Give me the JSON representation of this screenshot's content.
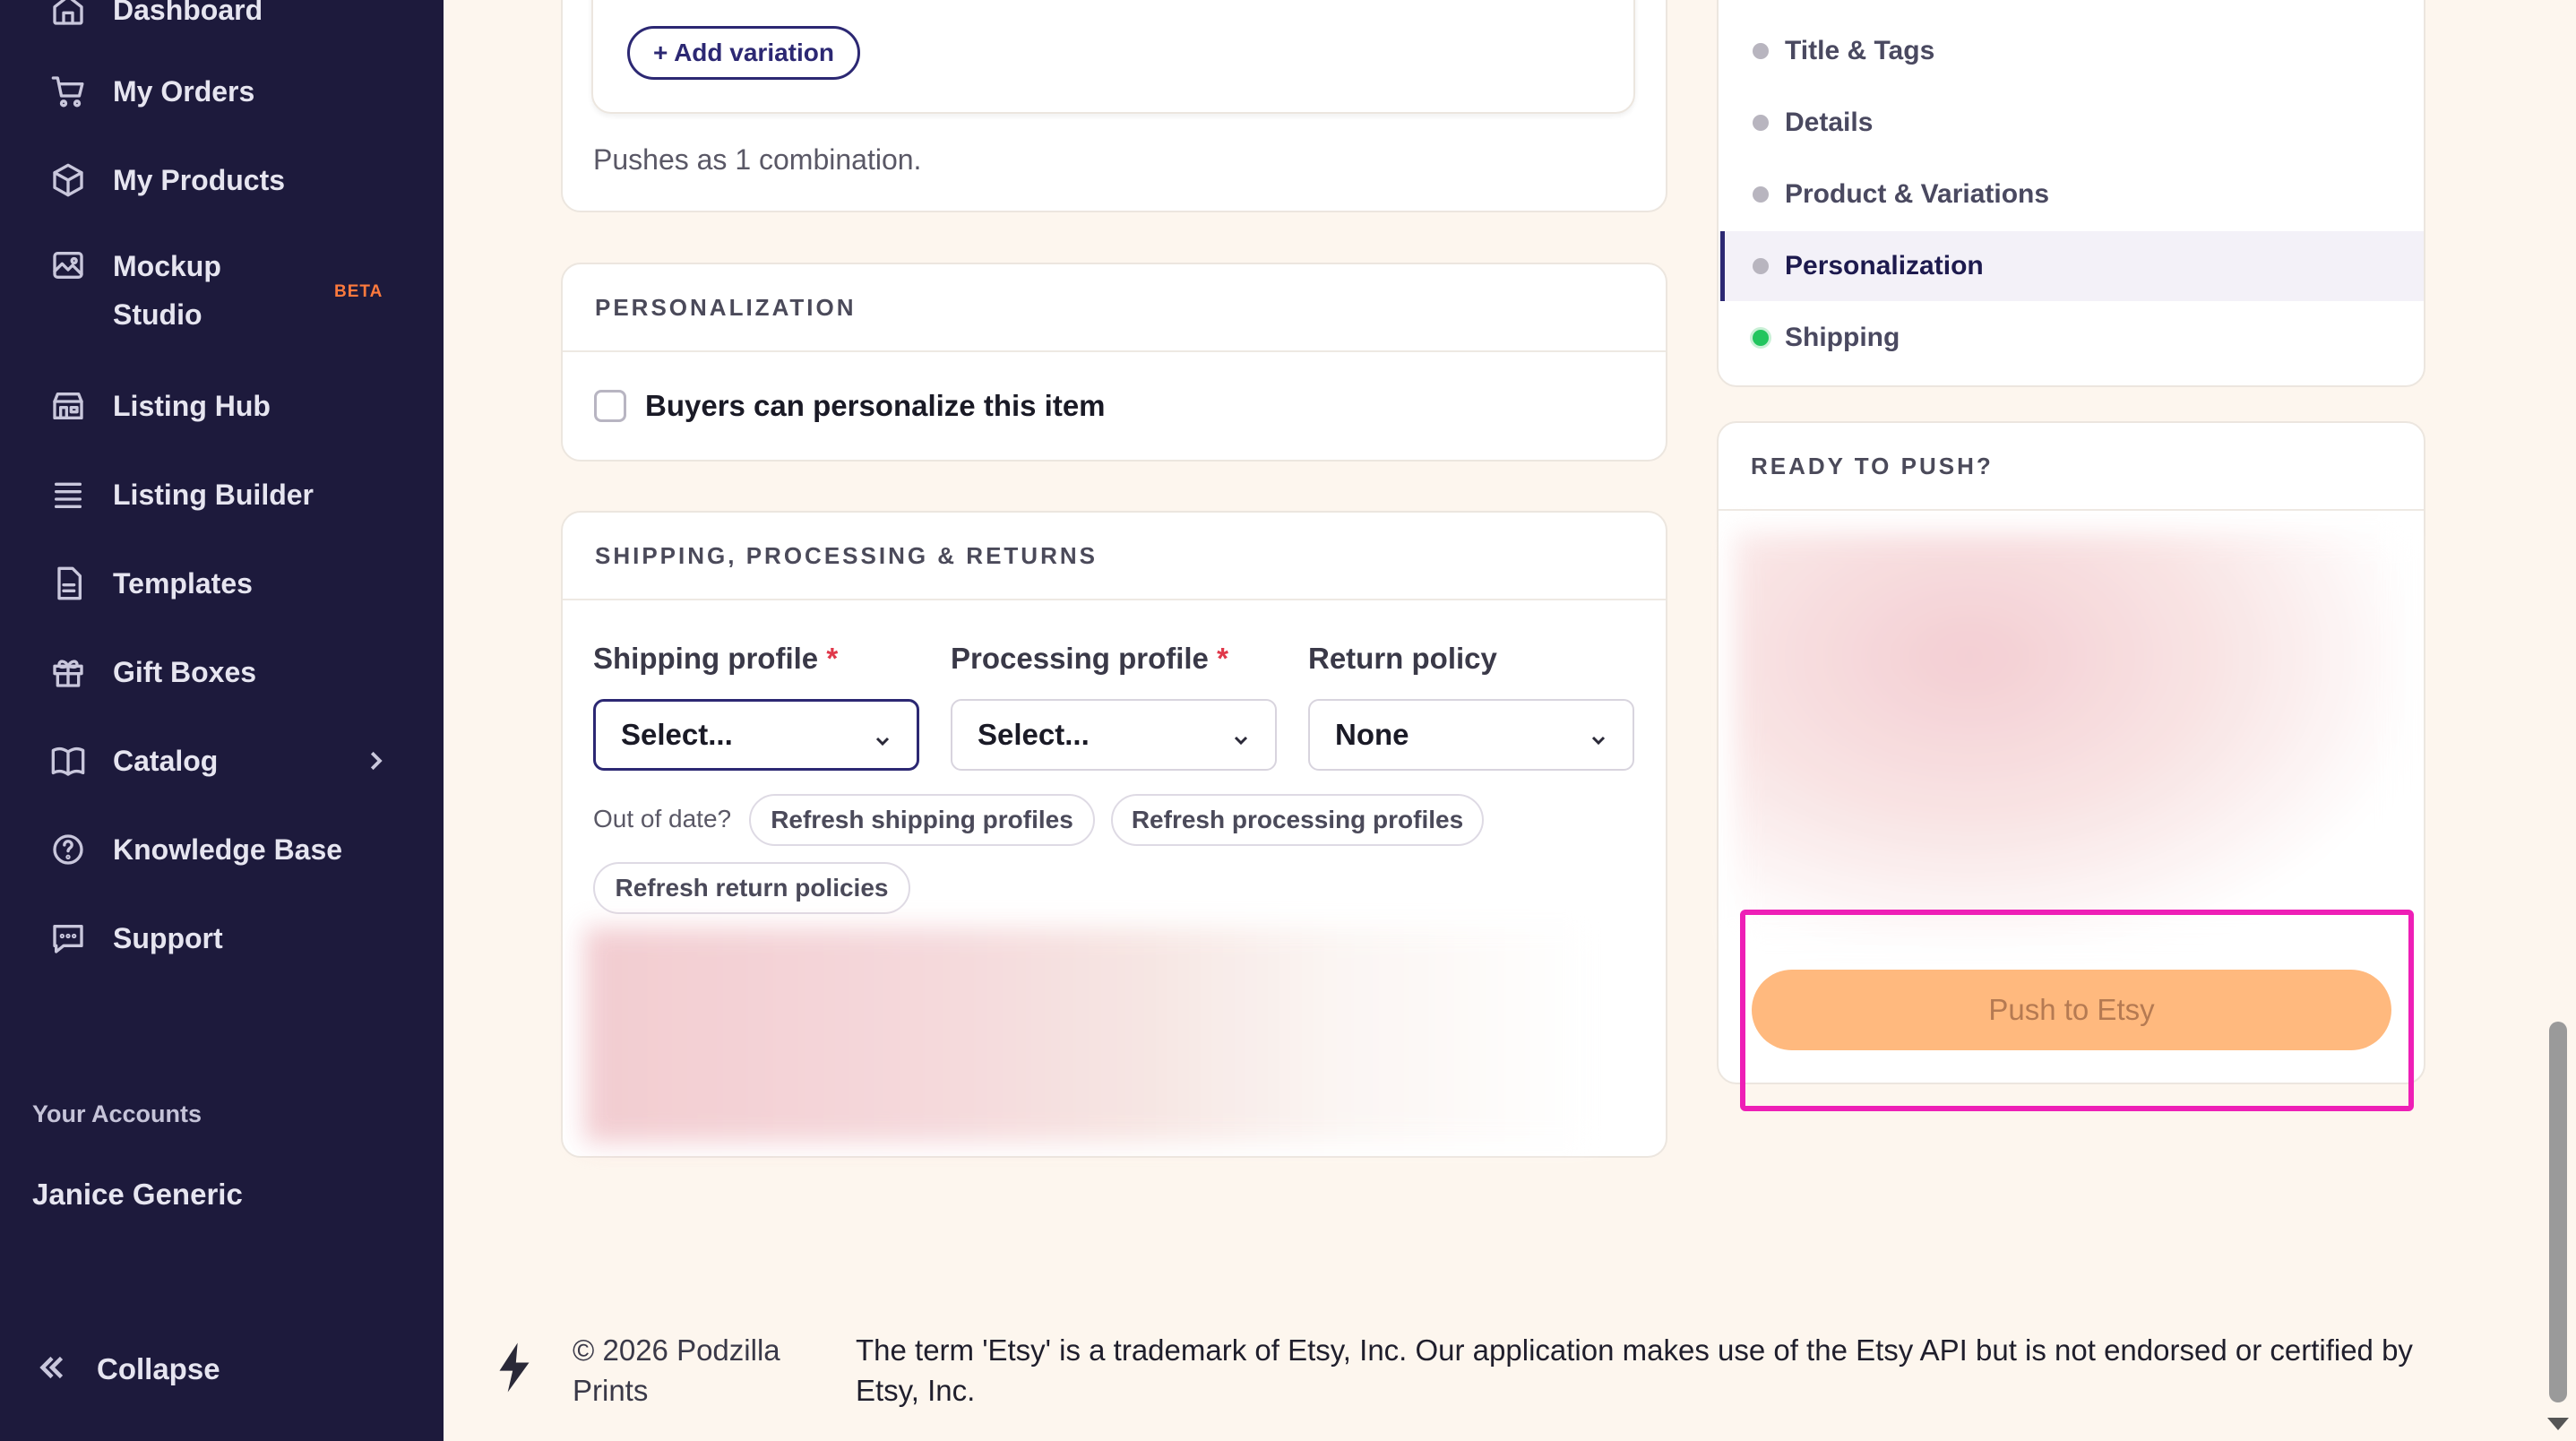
{
  "sidebar": {
    "items": [
      {
        "label": "Dashboard",
        "icon": "home-icon"
      },
      {
        "label": "My Orders",
        "icon": "cart-icon"
      },
      {
        "label": "My Products",
        "icon": "box-icon"
      },
      {
        "label": "Mockup Studio",
        "icon": "image-icon",
        "badge": "BETA"
      },
      {
        "label": "Listing Hub",
        "icon": "store-icon"
      },
      {
        "label": "Listing Builder",
        "icon": "list-icon"
      },
      {
        "label": "Templates",
        "icon": "document-icon"
      },
      {
        "label": "Gift Boxes",
        "icon": "gift-icon"
      },
      {
        "label": "Catalog",
        "icon": "book-icon"
      },
      {
        "label": "Knowledge Base",
        "icon": "help-circle-icon"
      },
      {
        "label": "Support",
        "icon": "chat-icon"
      }
    ],
    "mockup_line1": "Mockup",
    "mockup_line2": "Studio",
    "accounts_title": "Your Accounts",
    "account_name": "Janice Generic",
    "collapse_label": "Collapse"
  },
  "variations": {
    "add_variation_label": "+ Add variation",
    "pushes_note": "Pushes as 1 combination."
  },
  "personalization": {
    "title": "PERSONALIZATION",
    "checkbox_label": "Buyers can personalize this item",
    "checked": false
  },
  "shipping": {
    "title": "SHIPPING, PROCESSING & RETURNS",
    "shipping_profile_label": "Shipping profile",
    "processing_profile_label": "Processing profile",
    "return_policy_label": "Return policy",
    "required_mark": "*",
    "shipping_profile_value": "Select...",
    "processing_profile_value": "Select...",
    "return_policy_value": "None",
    "out_of_date": "Out of date?",
    "refresh_shipping": "Refresh shipping profiles",
    "refresh_processing": "Refresh processing profiles",
    "refresh_returns": "Refresh return policies"
  },
  "toc": {
    "items": [
      {
        "label": "Title & Tags",
        "status_color": "#b8b5bf"
      },
      {
        "label": "Details",
        "status_color": "#b8b5bf"
      },
      {
        "label": "Product & Variations",
        "status_color": "#b8b5bf"
      },
      {
        "label": "Personalization",
        "status_color": "#b8b5bf",
        "active": true
      },
      {
        "label": "Shipping",
        "status_color": "#22c55e"
      }
    ]
  },
  "ready": {
    "title": "READY TO PUSH?",
    "push_label": "Push to Etsy"
  },
  "footer": {
    "copyright": "© 2026 Podzilla Prints",
    "legal": "The term 'Etsy' is a trademark of Etsy, Inc. Our application makes use of the Etsy API but is not endorsed or certified by Etsy, Inc."
  },
  "colors": {
    "sidebar_bg": "#1d1a3c",
    "accent": "#2c2873",
    "push_button": "#ffb97e",
    "highlight": "#ee1fb6",
    "page_bg": "#fdf6ee"
  }
}
